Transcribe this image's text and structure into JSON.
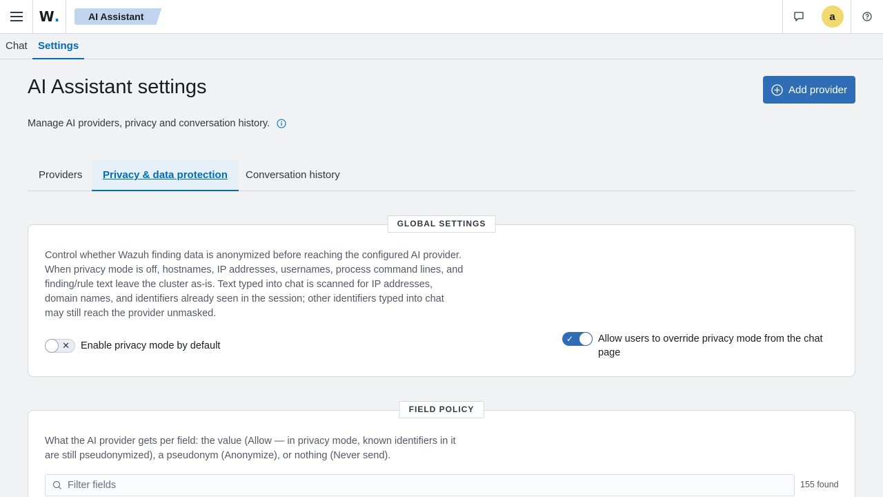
{
  "header": {
    "logo_text": "W",
    "logo_dot": ".",
    "breadcrumb": "AI Assistant",
    "avatar_initial": "a",
    "colors": {
      "accent": "#006bb8",
      "primary_button": "#2f6eb7",
      "avatar": "#f1d86f"
    },
    "icons": [
      "menu-icon",
      "chat-bubble-icon",
      "help-icon"
    ]
  },
  "topnav": {
    "tabs": [
      {
        "label": "Chat",
        "selected": false
      },
      {
        "label": "Settings",
        "selected": true
      }
    ]
  },
  "page": {
    "title": "AI Assistant settings",
    "add_button": "Add provider",
    "description": "Manage AI providers, privacy and conversation history.",
    "subtabs": [
      {
        "label": "Providers",
        "selected": false
      },
      {
        "label": "Privacy & data protection",
        "selected": true
      },
      {
        "label": "Conversation history",
        "selected": false
      }
    ]
  },
  "global_settings": {
    "legend": "GLOBAL SETTINGS",
    "text": "Control whether Wazuh finding data is anonymized before reaching the configured AI provider. When privacy mode is off, hostnames, IP addresses, usernames, process command lines, and finding/rule text leave the cluster as-is. Text typed into chat is scanned for IP addresses, domain names, and identifiers already seen in the session; other identifiers typed into chat may still reach the provider unmasked.",
    "privacy_toggle": {
      "label": "Enable privacy mode by default",
      "checked": false
    },
    "override_toggle": {
      "label": "Allow users to override privacy mode from the chat page",
      "checked": true
    }
  },
  "field_policy": {
    "legend": "FIELD POLICY",
    "text": "What the AI provider gets per field: the value (Allow — in privacy mode, known identifiers in it are still pseudonymized), a pseudonym (Anonymize), or nothing (Never send).",
    "filter_placeholder": "Filter fields",
    "found": "155 found"
  }
}
